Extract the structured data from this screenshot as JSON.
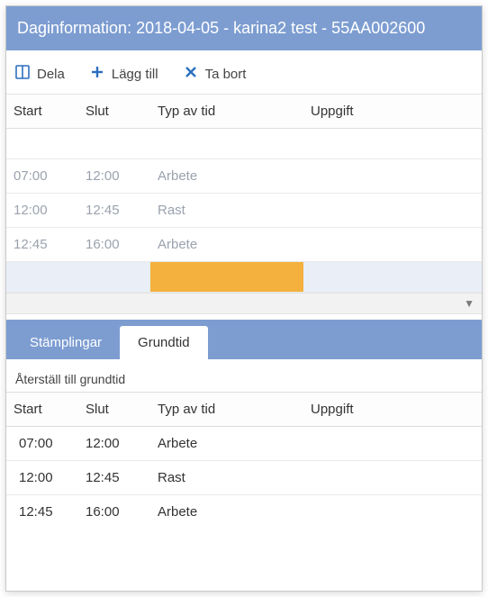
{
  "header": {
    "title": "Daginformation: 2018-04-05 - karina2 test - 55AA002600"
  },
  "toolbar": {
    "dela_label": "Dela",
    "lagg_till_label": "Lägg till",
    "ta_bort_label": "Ta bort"
  },
  "columns": {
    "start": "Start",
    "slut": "Slut",
    "typ": "Typ av tid",
    "uppgift": "Uppgift"
  },
  "upper_rows": [
    {
      "start": "07:00",
      "slut": "12:00",
      "typ": "Arbete",
      "uppgift": ""
    },
    {
      "start": "12:00",
      "slut": "12:45",
      "typ": "Rast",
      "uppgift": ""
    },
    {
      "start": "12:45",
      "slut": "16:00",
      "typ": "Arbete",
      "uppgift": ""
    }
  ],
  "tabs": {
    "stamplingar": "Stämplingar",
    "grundtid": "Grundtid"
  },
  "reset_label": "Återställ till grundtid",
  "lower_rows": [
    {
      "start": "07:00",
      "slut": "12:00",
      "typ": "Arbete",
      "uppgift": ""
    },
    {
      "start": "12:00",
      "slut": "12:45",
      "typ": "Rast",
      "uppgift": ""
    },
    {
      "start": "12:45",
      "slut": "16:00",
      "typ": "Arbete",
      "uppgift": ""
    }
  ]
}
